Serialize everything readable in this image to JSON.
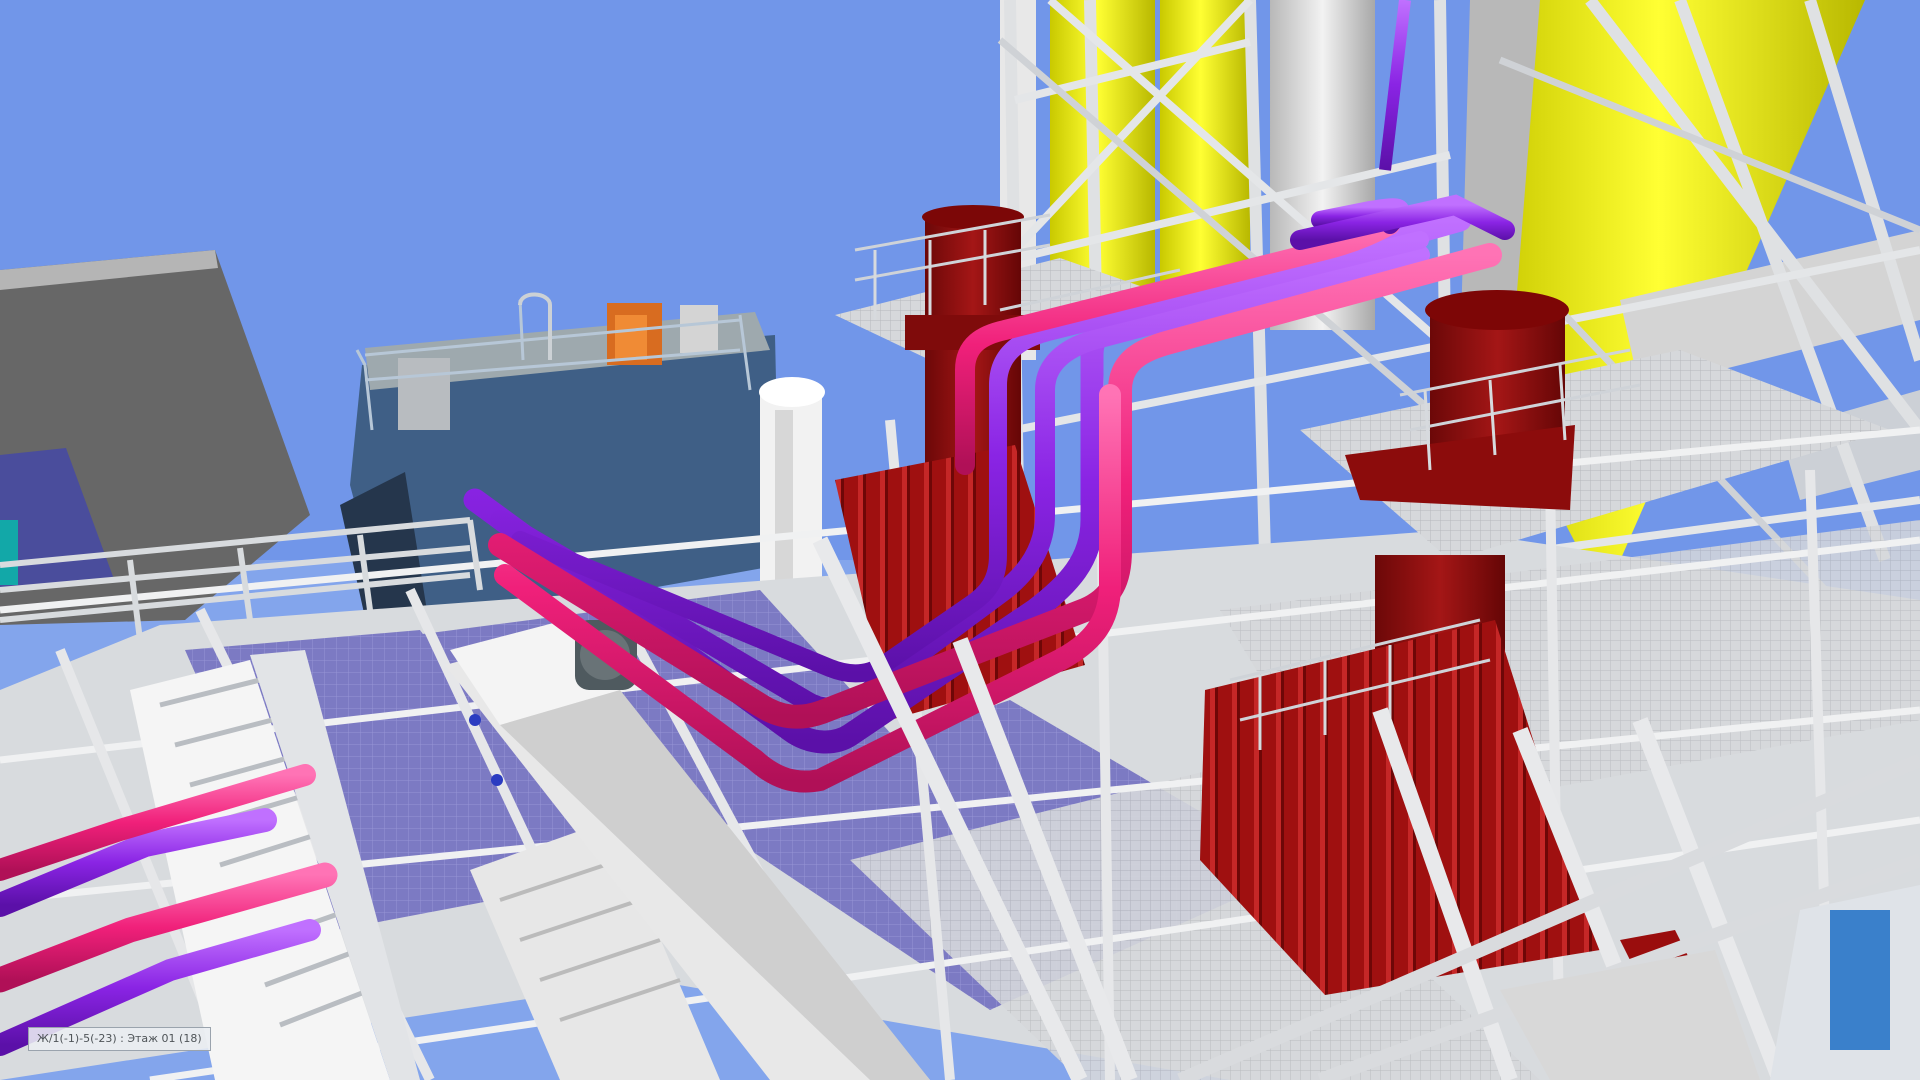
{
  "viewport": {
    "status_label": "Ж/1(-1)-5(-23) : Этаж 01 (18)"
  },
  "colors": {
    "sky": "#6f90e8",
    "steel": "#cfd3d6",
    "grating": "#7f7fc7",
    "tank_red": "#8d0f0f",
    "silo_yellow": "#f2f20d",
    "pipe_purple": "#8d2ee6",
    "pipe_magenta": "#f0207a",
    "building_dark": "#6a6a6a",
    "hopper_blue": "#3f5f86",
    "motor_orange": "#d86c20"
  }
}
